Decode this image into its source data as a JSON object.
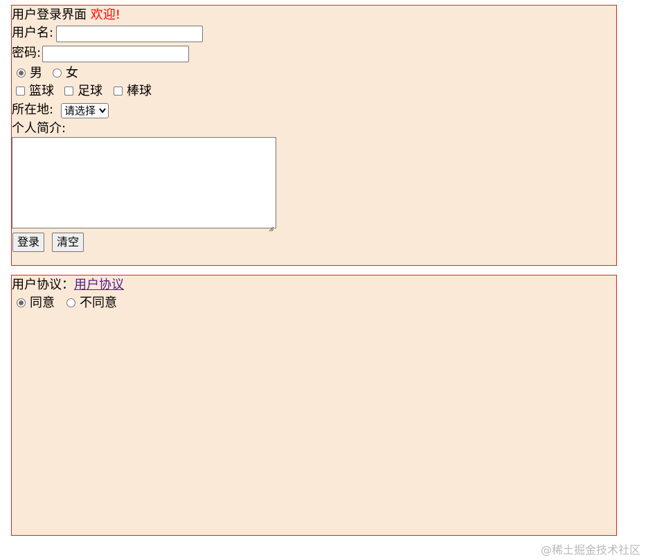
{
  "login_form": {
    "title": "用户登录界面",
    "welcome": "欢迎!",
    "username_label": "用户名:",
    "username_value": "",
    "password_label": "密码:",
    "password_value": "",
    "gender_options": [
      {
        "label": "男",
        "checked": true
      },
      {
        "label": "女",
        "checked": false
      }
    ],
    "hobby_options": [
      {
        "label": "篮球",
        "checked": false
      },
      {
        "label": "足球",
        "checked": false
      },
      {
        "label": "棒球",
        "checked": false
      }
    ],
    "location_label": "所在地:",
    "location_selected": "请选择",
    "bio_label": "个人简介:",
    "bio_value": "",
    "login_button": "登录",
    "clear_button": "清空"
  },
  "agreement": {
    "label": "用户协议：",
    "link_text": "用户协议",
    "options": [
      {
        "label": "同意",
        "checked": true
      },
      {
        "label": "不同意",
        "checked": false
      }
    ]
  },
  "watermark": "@稀土掘金技术社区",
  "colors": {
    "panel_background": "#fbe9d7",
    "panel_border": "#e0201f",
    "welcome_text": "#ff0000",
    "link_visited": "#551a8b"
  }
}
